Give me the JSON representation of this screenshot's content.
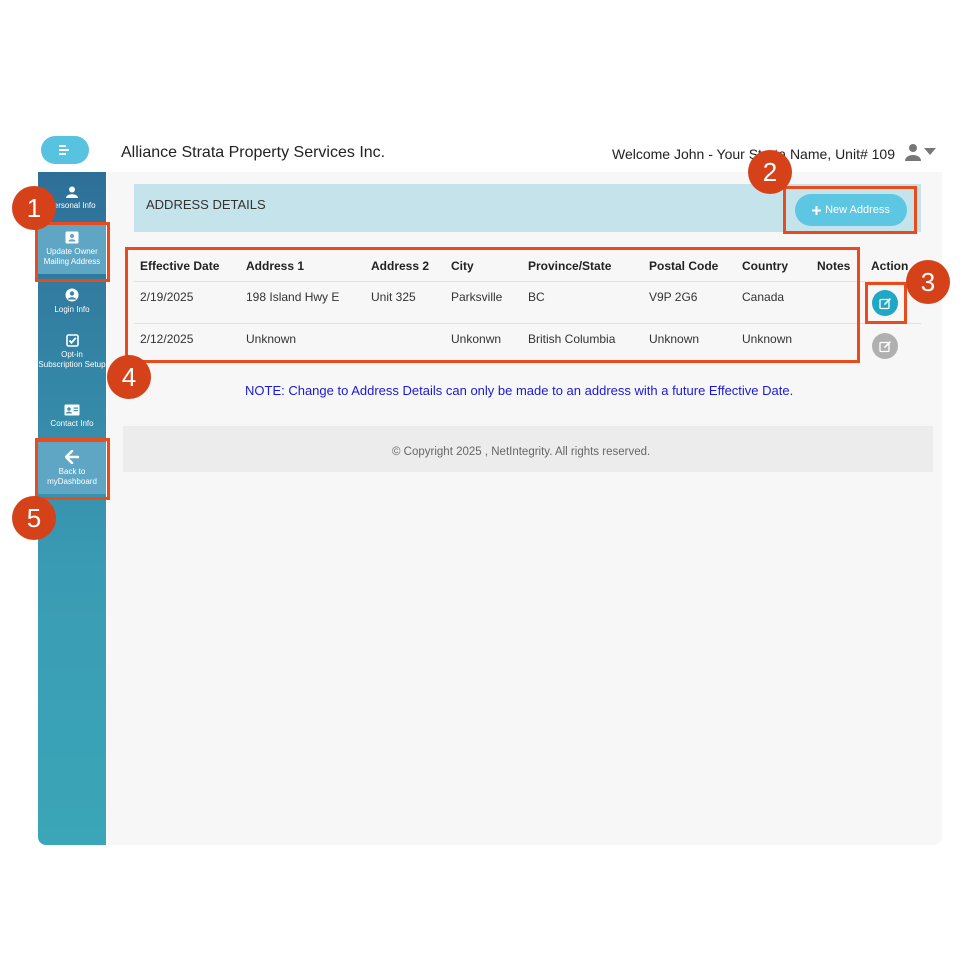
{
  "app": {
    "brand": "Alliance Strata Property Services Inc.",
    "welcome": "Welcome John - Your Strata Name, Unit# 109"
  },
  "sidebar": {
    "items": [
      {
        "label": "Personal Info",
        "icon": "person-icon"
      },
      {
        "label": "Update Owner Mailing Address",
        "icon": "contact-card-icon"
      },
      {
        "label": "Login Info",
        "icon": "user-circle-icon"
      },
      {
        "label": "Opt-in Subscription Setup",
        "icon": "checkbox-icon"
      },
      {
        "label": "Contact Info",
        "icon": "address-card-icon"
      },
      {
        "label": "Back to myDashboard",
        "icon": "arrow-left-icon"
      }
    ]
  },
  "address": {
    "title": "ADDRESS DETAILS",
    "new_button": "New Address",
    "columns": [
      "Effective Date",
      "Address 1",
      "Address 2",
      "City",
      "Province/State",
      "Postal Code",
      "Country",
      "Notes",
      "Action"
    ],
    "rows": [
      [
        "2/19/2025",
        "198 Island Hwy E",
        "Unit 325",
        "Parksville",
        "BC",
        "V9P 2G6",
        "Canada",
        ""
      ],
      [
        "2/12/2025",
        "Unknown",
        "",
        "Unkonwn",
        "British Columbia",
        "Unknown",
        "Unknown",
        ""
      ]
    ],
    "note": "NOTE: Change to Address Details can only be made to an address with a future Effective Date."
  },
  "footer": {
    "copyright": "© Copyright 2025 , NetIntegrity. All rights reserved."
  },
  "annotations": [
    "1",
    "2",
    "3",
    "4",
    "5"
  ],
  "colors": {
    "accent": "#5cc6e3",
    "highlight": "#e94b1d",
    "badge": "#d5421a",
    "note": "#1a1adb"
  }
}
